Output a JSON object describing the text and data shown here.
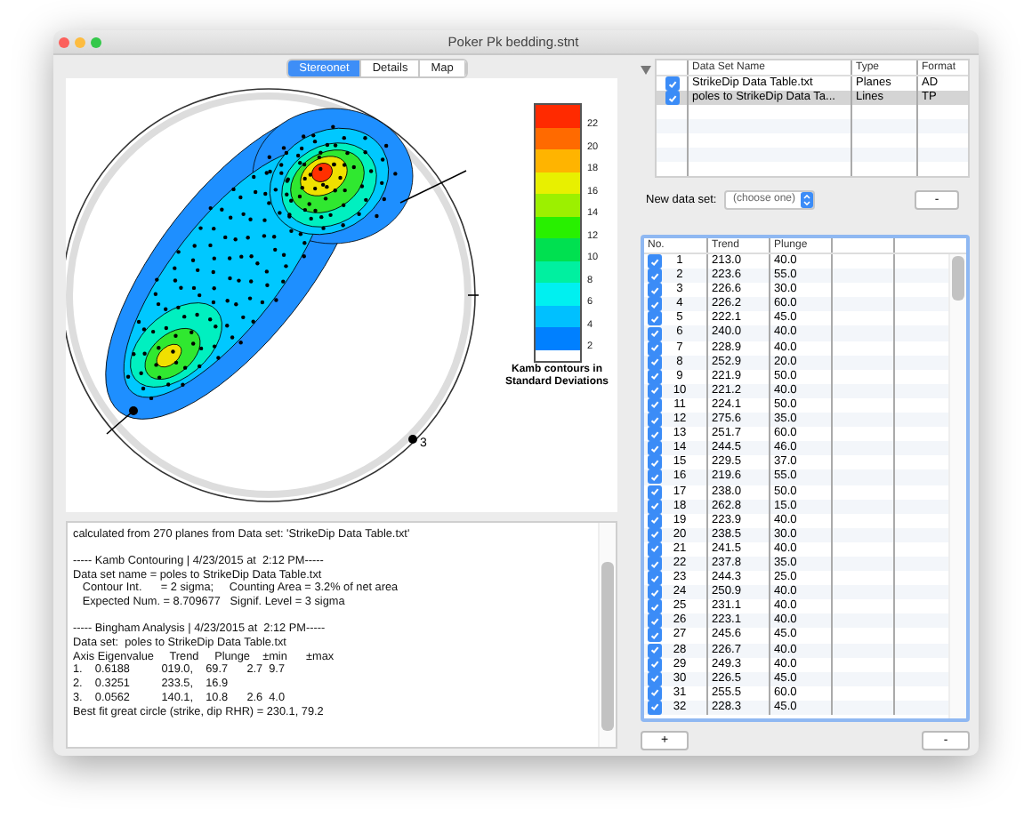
{
  "window": {
    "title": "Poker Pk bedding.stnt"
  },
  "tabs": [
    {
      "label": "Stereonet",
      "selected": true
    },
    {
      "label": "Details",
      "selected": false
    },
    {
      "label": "Map",
      "selected": false
    }
  ],
  "stereonet": {
    "point_label": "3",
    "legend": {
      "title": "Kamb contours in Standard Deviations",
      "ticks": [
        "22",
        "20",
        "18",
        "16",
        "14",
        "12",
        "10",
        "8",
        "6",
        "4",
        "2"
      ],
      "bands": [
        {
          "color": "#ff2a00"
        },
        {
          "color": "#ff6a00"
        },
        {
          "color": "#ffb400"
        },
        {
          "color": "#e8f000"
        },
        {
          "color": "#9cf000"
        },
        {
          "color": "#28f000"
        },
        {
          "color": "#00e050"
        },
        {
          "color": "#00f0a0"
        },
        {
          "color": "#00f0f0"
        },
        {
          "color": "#00c0ff"
        },
        {
          "color": "#0080ff"
        }
      ]
    }
  },
  "report": [
    [
      "calculated from 270 planes from Data set: 'StrikeDip Data Table.txt'"
    ],
    [
      "----- Kamb Contouring | 4/23/2015 at  2:12 PM-----",
      "Data set name = poles to StrikeDip Data Table.txt",
      "   Contour Int.      = 2 sigma;     Counting Area = 3.2% of net area",
      "   Expected Num. = 8.709677   Signif. Level = 3 sigma"
    ],
    [
      "----- Bingham Analysis | 4/23/2015 at  2:12 PM-----",
      "Data set:  poles to StrikeDip Data Table.txt",
      "Axis Eigenvalue     Trend     Plunge    ±min      ±max",
      "1.    0.6188          019.0,    69.7      2.7  9.7",
      "2.    0.3251          233.5,    16.9",
      "3.    0.0562          140.1,    10.8      2.6  4.0",
      "Best fit great circle (strike, dip RHR) = 230.1, 79.2"
    ]
  ],
  "datasets": {
    "columns": [
      "Data Set Name",
      "Type",
      "Format"
    ],
    "rows": [
      {
        "checked": true,
        "selected": false,
        "name": "StrikeDip Data Table.txt",
        "type": "Planes",
        "format": "AD"
      },
      {
        "checked": true,
        "selected": true,
        "name": "poles to StrikeDip Data Ta...",
        "type": "Lines",
        "format": "TP"
      }
    ]
  },
  "new_data_set": {
    "label": "New data set:",
    "value": "(choose one)",
    "remove": "-"
  },
  "table": {
    "columns": [
      "No.",
      "Trend",
      "Plunge"
    ],
    "rows": [
      {
        "checked": true,
        "no": "1",
        "trend": "213.0",
        "plunge": "40.0"
      },
      {
        "checked": true,
        "no": "2",
        "trend": "223.6",
        "plunge": "55.0"
      },
      {
        "checked": true,
        "no": "3",
        "trend": "226.6",
        "plunge": "30.0"
      },
      {
        "checked": true,
        "no": "4",
        "trend": "226.2",
        "plunge": "60.0"
      },
      {
        "checked": true,
        "no": "5",
        "trend": "222.1",
        "plunge": "45.0"
      },
      {
        "checked": true,
        "no": "6",
        "trend": "240.0",
        "plunge": "40.0"
      },
      {
        "checked": true,
        "no": "7",
        "trend": "228.9",
        "plunge": "40.0"
      },
      {
        "checked": true,
        "no": "8",
        "trend": "252.9",
        "plunge": "20.0"
      },
      {
        "checked": true,
        "no": "9",
        "trend": "221.9",
        "plunge": "50.0"
      },
      {
        "checked": true,
        "no": "10",
        "trend": "221.2",
        "plunge": "40.0"
      },
      {
        "checked": true,
        "no": "11",
        "trend": "224.1",
        "plunge": "50.0"
      },
      {
        "checked": true,
        "no": "12",
        "trend": "275.6",
        "plunge": "35.0"
      },
      {
        "checked": true,
        "no": "13",
        "trend": "251.7",
        "plunge": "60.0"
      },
      {
        "checked": true,
        "no": "14",
        "trend": "244.5",
        "plunge": "46.0"
      },
      {
        "checked": true,
        "no": "15",
        "trend": "229.5",
        "plunge": "37.0"
      },
      {
        "checked": true,
        "no": "16",
        "trend": "219.6",
        "plunge": "55.0"
      },
      {
        "checked": true,
        "no": "17",
        "trend": "238.0",
        "plunge": "50.0"
      },
      {
        "checked": true,
        "no": "18",
        "trend": "262.8",
        "plunge": "15.0"
      },
      {
        "checked": true,
        "no": "19",
        "trend": "223.9",
        "plunge": "40.0"
      },
      {
        "checked": true,
        "no": "20",
        "trend": "238.5",
        "plunge": "30.0"
      },
      {
        "checked": true,
        "no": "21",
        "trend": "241.5",
        "plunge": "40.0"
      },
      {
        "checked": true,
        "no": "22",
        "trend": "237.8",
        "plunge": "35.0"
      },
      {
        "checked": true,
        "no": "23",
        "trend": "244.3",
        "plunge": "25.0"
      },
      {
        "checked": true,
        "no": "24",
        "trend": "250.9",
        "plunge": "40.0"
      },
      {
        "checked": true,
        "no": "25",
        "trend": "231.1",
        "plunge": "40.0"
      },
      {
        "checked": true,
        "no": "26",
        "trend": "223.1",
        "plunge": "40.0"
      },
      {
        "checked": true,
        "no": "27",
        "trend": "245.6",
        "plunge": "45.0"
      },
      {
        "checked": true,
        "no": "28",
        "trend": "226.7",
        "plunge": "40.0"
      },
      {
        "checked": true,
        "no": "29",
        "trend": "249.3",
        "plunge": "40.0"
      },
      {
        "checked": true,
        "no": "30",
        "trend": "226.5",
        "plunge": "45.0"
      },
      {
        "checked": true,
        "no": "31",
        "trend": "255.5",
        "plunge": "60.0"
      },
      {
        "checked": true,
        "no": "32",
        "trend": "228.3",
        "plunge": "45.0"
      }
    ]
  },
  "footer_buttons": [
    "+",
    "-"
  ]
}
